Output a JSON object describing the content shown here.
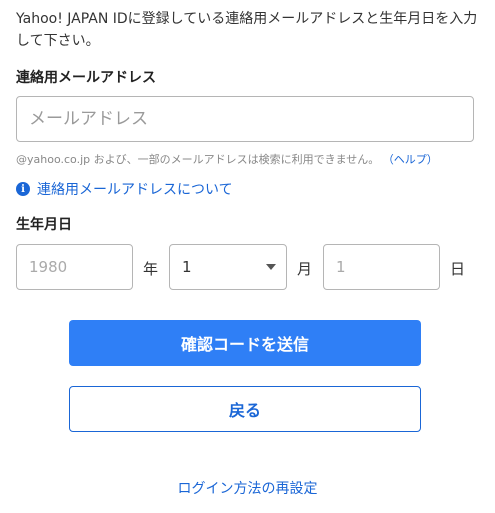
{
  "intro_text": "Yahoo! JAPAN IDに登録している連絡用メールアドレスと生年月日を入力して下さい。",
  "email": {
    "label": "連絡用メールアドレス",
    "placeholder": "メールアドレス",
    "value": "",
    "note": "@yahoo.co.jp および、一部のメールアドレスは検索に利用できません。",
    "help_link": "（ヘルプ）",
    "info_link": "連絡用メールアドレスについて"
  },
  "birthdate": {
    "label": "生年月日",
    "year_placeholder": "1980",
    "year_unit": "年",
    "month_value": "1",
    "month_unit": "月",
    "day_placeholder": "1",
    "day_unit": "日"
  },
  "buttons": {
    "send_code": "確認コードを送信",
    "back": "戻る"
  },
  "bottom_link": "ログイン方法の再設定",
  "colors": {
    "primary": "#2f7ff6",
    "link": "#1a66d6"
  }
}
